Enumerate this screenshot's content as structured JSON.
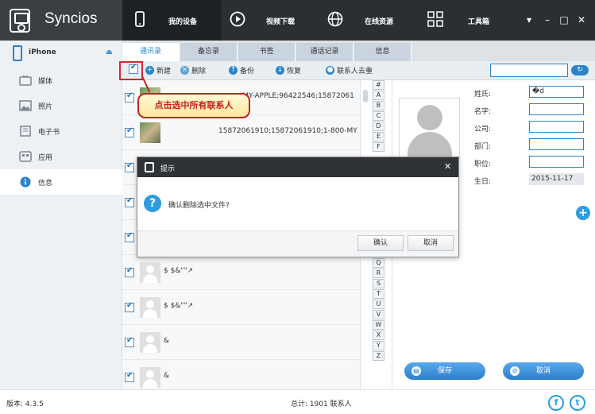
{
  "app": {
    "name": "Syncios"
  },
  "nav": [
    {
      "label": "我的设备",
      "icon": "phone-icon"
    },
    {
      "label": "视频下载",
      "icon": "play-icon"
    },
    {
      "label": "在线资源",
      "icon": "globe-icon"
    },
    {
      "label": "工具箱",
      "icon": "grid-icon"
    }
  ],
  "window": {
    "menu": "▾",
    "minimize": "–",
    "maximize": "□",
    "close": "✕"
  },
  "sidebar": {
    "device": "iPhone",
    "eject": "⏏",
    "items": [
      {
        "label": "媒体",
        "icon": "tv-icon"
      },
      {
        "label": "照片",
        "icon": "photo-icon"
      },
      {
        "label": "电子书",
        "icon": "book-icon"
      },
      {
        "label": "应用",
        "icon": "apps-icon"
      },
      {
        "label": "信息",
        "icon": "info-icon"
      }
    ]
  },
  "subtabs": [
    "通讯录",
    "备忘录",
    "书签",
    "通话记录",
    "信息"
  ],
  "toolbar": {
    "new": "新建",
    "delete": "删除",
    "backup": "备份",
    "restore": "恢复",
    "dedupe": "联系人去重",
    "search_placeholder": ""
  },
  "contacts": [
    {
      "name": "",
      "phone": "-MY-APPLE;96422546;15872061",
      "photo": true
    },
    {
      "name": "",
      "phone": "15872061910;15872061910;1-800-MY",
      "photo": true
    },
    {
      "name": "",
      "phone": "",
      "photo": false
    },
    {
      "name": "",
      "phone": "",
      "photo": false
    },
    {
      "name": "",
      "phone": "",
      "photo": false
    },
    {
      "name": "",
      "phone": "",
      "photo": false
    },
    {
      "name": "$  $&\"\"↗",
      "phone": "",
      "photo": false
    },
    {
      "name": "$  $&\"\"↗",
      "phone": "",
      "photo": false
    },
    {
      "name": "&",
      "phone": "",
      "photo": false
    },
    {
      "name": "&",
      "phone": "",
      "photo": false
    }
  ],
  "alphabet_top": [
    "#",
    "A",
    "B",
    "C",
    "D",
    "E",
    "F"
  ],
  "alphabet_bottom": [
    "Q",
    "R",
    "S",
    "T",
    "U",
    "V",
    "W",
    "X",
    "Y",
    "Z"
  ],
  "detail": {
    "fields": [
      {
        "label": "姓氏:",
        "value": "�d"
      },
      {
        "label": "名字:",
        "value": ""
      },
      {
        "label": "公司:",
        "value": ""
      },
      {
        "label": "部门:",
        "value": ""
      },
      {
        "label": "职位:",
        "value": ""
      }
    ],
    "birthday_label": "生日:",
    "birthday_value": "2015-11-17",
    "add": "+",
    "save": "保存",
    "cancel": "取消"
  },
  "callout": "点击选中所有联系人",
  "dialog": {
    "title": "提示",
    "message": "确认删除选中文件?",
    "confirm": "确认",
    "cancel": "取消",
    "close": "✕",
    "icon": "?"
  },
  "status": {
    "version": "版本: 4.3.5",
    "total": "总计: 1901 联系人",
    "facebook": "f",
    "twitter": "t"
  }
}
